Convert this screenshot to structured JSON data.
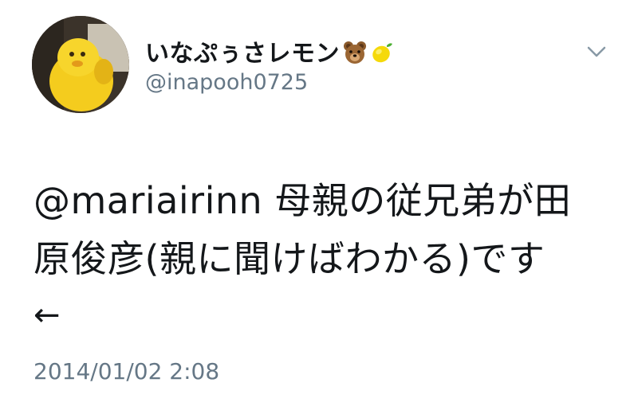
{
  "user": {
    "display_name": "いなぷぅさレモン",
    "handle": "@inapooh0725",
    "avatar_icon": "avatar-photo-icon",
    "name_emojis": [
      "bear-face-icon",
      "lemon-icon"
    ]
  },
  "tweet": {
    "text": "@mariairinn 母親の従兄弟が田\n原俊彦(親に聞けばわかる)です",
    "arrow_glyph": "←",
    "timestamp": "2014/01/02 2:08"
  },
  "menu": {
    "icon": "chevron-down-icon"
  },
  "colors": {
    "text": "#14171a",
    "secondary": "#657786"
  }
}
